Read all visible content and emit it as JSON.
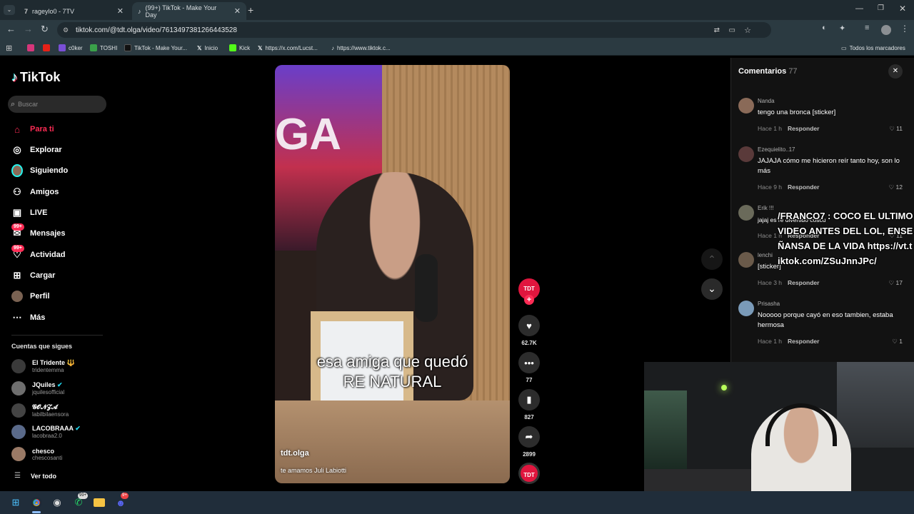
{
  "browser": {
    "tabs": [
      {
        "title": "rageylo0 - 7TV",
        "active": false
      },
      {
        "title": "(99+) TikTok - Make Your Day",
        "active": true
      }
    ],
    "url": "tiktok.com/@tdt.olga/video/7613497381266443528",
    "bookmarks": [
      "c0ker",
      "TOSHI",
      "TikTok - Make Your...",
      "Inicio",
      "Kick",
      "https://x.com/Lucst...",
      "https://www.tiktok.c..."
    ],
    "all_bookmarks": "Todos los marcadores"
  },
  "sidebar": {
    "logo": "TikTok",
    "search_placeholder": "Buscar",
    "nav": [
      {
        "label": "Para ti",
        "icon": "home-icon",
        "active": true
      },
      {
        "label": "Explorar",
        "icon": "compass-icon"
      },
      {
        "label": "Siguiendo",
        "icon": "following-avatar-icon"
      },
      {
        "label": "Amigos",
        "icon": "friends-icon"
      },
      {
        "label": "LIVE",
        "icon": "live-tv-icon"
      },
      {
        "label": "Mensajes",
        "icon": "messages-icon",
        "badge": "99+"
      },
      {
        "label": "Actividad",
        "icon": "activity-icon",
        "badge": "99+"
      },
      {
        "label": "Cargar",
        "icon": "upload-icon"
      },
      {
        "label": "Perfil",
        "icon": "profile-avatar-icon"
      },
      {
        "label": "Más",
        "icon": "more-icon"
      }
    ],
    "following_title": "Cuentas que sigues",
    "accounts": [
      {
        "name": "El Tridente 🔱",
        "handle": "tridentemma"
      },
      {
        "name": "JQuiles",
        "handle": "jquilesofficial",
        "verified": true
      },
      {
        "name": "𝓖𝓞𝓝𝓩𝓐",
        "handle": "labilbilaensora"
      },
      {
        "name": "LACOBRAAA",
        "handle": "lacobraa2.0",
        "verified": true
      },
      {
        "name": "chesco",
        "handle": "chescosanti"
      }
    ],
    "see_all": "Ver todo"
  },
  "video": {
    "caption_line1": "esa amiga que quedó",
    "caption_line2": "RE NATURAL",
    "author": "tdt.olga",
    "description": "te amamos Juli Labiotti",
    "likes": "62.7K",
    "comments": "77",
    "saves": "827",
    "shares": "2899",
    "avatar_label": "TDT",
    "sign_letters": "GA"
  },
  "comments_panel": {
    "title": "Comentarios",
    "count": "77",
    "reply_label": "Responder",
    "items": [
      {
        "user": "Nanda",
        "text": "tengo una bronca [sticker]",
        "time": "Hace 1 h",
        "likes": "11"
      },
      {
        "user": "Ezequielito..17",
        "text": "JAJAJA cómo me hicieron reír tanto hoy, son lo más",
        "time": "Hace 9 h",
        "likes": "12"
      },
      {
        "user": "Erik !!!",
        "text": "jajaj es re divertido coscu",
        "time": "Hace 1 h",
        "likes": "11"
      },
      {
        "user": "lenchi",
        "text": "[sticker]",
        "time": "Hace 3 h",
        "likes": "17"
      },
      {
        "user": "Prisasha",
        "text": "Nooooo porque cayó en eso tambien, estaba hermosa",
        "time": "Hace 1 h",
        "likes": "1"
      }
    ]
  },
  "overlay": {
    "chat_text": "/FRANCO7 : COCO EL ULTIMO VIDEO ANTES DEL LOL, ENSEÑANSA DE LA VIDA https://vt.tiktok.com/ZSuJnnJPc/"
  },
  "taskbar": {
    "whatsapp_badge": "99+",
    "discord_badge": "9+"
  },
  "colors": {
    "accent": "#fe2c55",
    "sidebar_bg": "#000000",
    "panel_bg": "#121212"
  }
}
